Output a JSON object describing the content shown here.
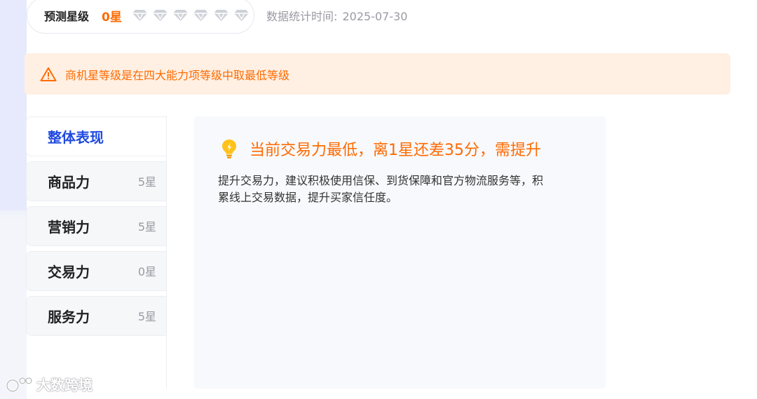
{
  "rating": {
    "label": "预测星级",
    "value": "0星",
    "diamond_count": 6,
    "diamond_color": "#cfd1d8",
    "value_color": "#ff6a00"
  },
  "stat_time": {
    "label": "数据统计时间:",
    "date": "2025-07-30"
  },
  "notice": {
    "icon": "warning-triangle-icon",
    "text": "商机星等级是在四大能力项等级中取最低等级",
    "color": "#ff6a00",
    "background": "#fff0e3"
  },
  "tabs": [
    {
      "label": "整体表现",
      "stars": "",
      "active": true
    },
    {
      "label": "商品力",
      "stars": "5星",
      "active": false
    },
    {
      "label": "营销力",
      "stars": "5星",
      "active": false
    },
    {
      "label": "交易力",
      "stars": "0星",
      "active": false
    },
    {
      "label": "服务力",
      "stars": "5星",
      "active": false
    }
  ],
  "active_tab_color": "#1f4ae0",
  "card": {
    "icon": "lightbulb-icon",
    "title": "当前交易力最低，离1星还差35分，需提升",
    "body_line1": "提升交易力，建议积极使用信保、到货保障和官方物流服务等，积",
    "body_line2": "累线上交易数据，提升买家信任度。"
  },
  "watermark": {
    "text": "大数跨境"
  }
}
